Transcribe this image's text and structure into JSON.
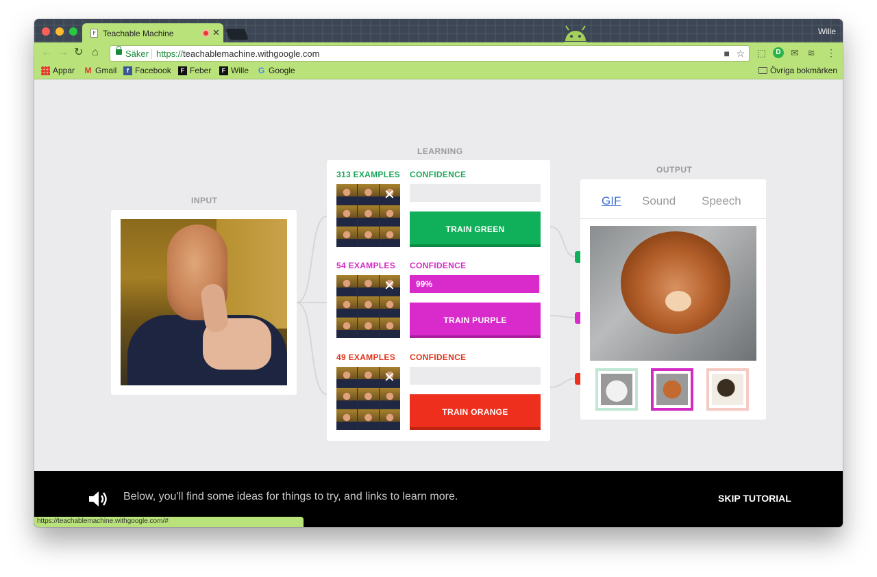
{
  "browser": {
    "tab_title": "Teachable Machine",
    "tab_favicon": "F",
    "profile_name": "Wille",
    "secure_label": "Säker",
    "url_scheme": "https://",
    "url_host": "teachablemachine.withgoogle.com",
    "status_url": "https://teachablemachine.withgoogle.com/#"
  },
  "bookmarks": {
    "apps": "Appar",
    "gmail": "Gmail",
    "facebook": "Facebook",
    "feber": "Feber",
    "wille": "Wille",
    "google": "Google",
    "other": "Övriga bokmärken"
  },
  "sections": {
    "input": "INPUT",
    "learning": "LEARNING",
    "output": "OUTPUT"
  },
  "classes": [
    {
      "examples": "313 EXAMPLES",
      "confidence_label": "CONFIDENCE",
      "confidence_text": "",
      "confidence": 0,
      "button": "TRAIN GREEN",
      "color": "#10b05a"
    },
    {
      "examples": "54 EXAMPLES",
      "confidence_label": "CONFIDENCE",
      "confidence_text": "99%",
      "confidence": 0.99,
      "button": "TRAIN PURPLE",
      "color": "#d92bcb"
    },
    {
      "examples": "49 EXAMPLES",
      "confidence_label": "CONFIDENCE",
      "confidence_text": "",
      "confidence": 0,
      "button": "TRAIN ORANGE",
      "color": "#ef2f1d"
    }
  ],
  "output": {
    "tabs": [
      "GIF",
      "Sound",
      "Speech"
    ],
    "active_tab": "GIF",
    "selected_gif": 1
  },
  "tutorial": {
    "text": "Below, you'll find some ideas for things to try, and links to learn more.",
    "skip": "SKIP TUTORIAL"
  },
  "colors": {
    "chrome_theme": "#b9e27a",
    "green": "#10b05a",
    "purple": "#d92bcb",
    "orange": "#ef2f1d"
  }
}
